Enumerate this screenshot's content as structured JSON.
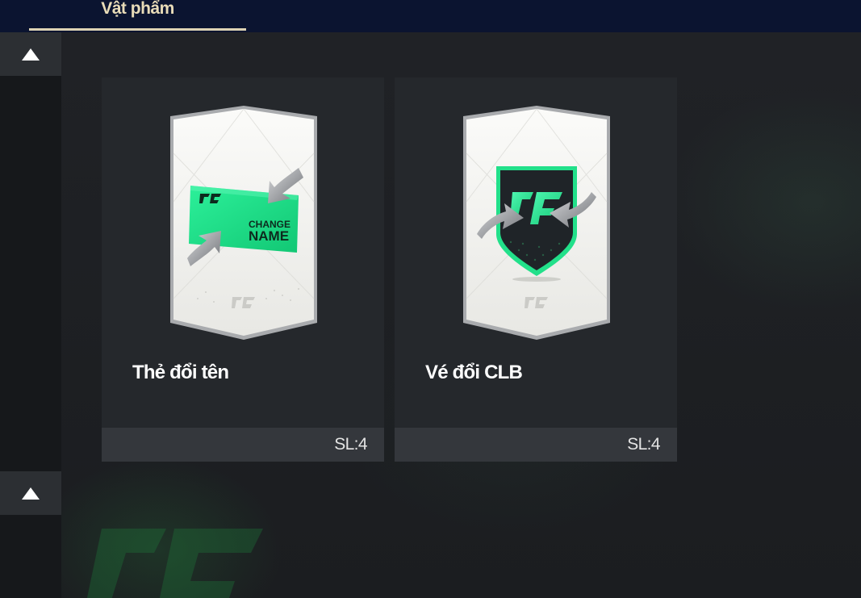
{
  "header": {
    "tab_label": "Vật phẩm"
  },
  "rail": {
    "up_icon_top": "triangle-up-icon",
    "up_icon_bottom": "triangle-up-icon"
  },
  "items": [
    {
      "title": "Thẻ đổi tên",
      "quantity": "SL:4",
      "icon": "change-name-card-icon",
      "icon_text_line1": "CHANGE",
      "icon_text_line2": "NAME"
    },
    {
      "title": "Vé đổi CLB",
      "quantity": "SL:4",
      "icon": "club-transfer-shield-icon"
    }
  ],
  "colors": {
    "accent_green": "#22e08a",
    "tab_gold": "#e9dcb8",
    "card_bg": "#25282c"
  }
}
